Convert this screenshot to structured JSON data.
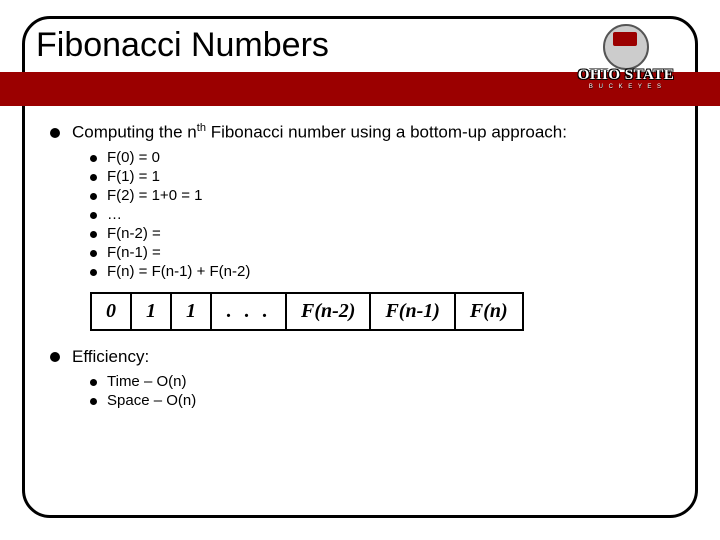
{
  "title": "Fibonacci Numbers",
  "logo": {
    "main": "OHIO STATE",
    "sub": "B U C K E Y E S"
  },
  "sections": [
    {
      "heading_pre": "Computing the n",
      "heading_sup": "th",
      "heading_post": " Fibonacci number using a bottom-up approach:",
      "items": [
        "F(0) = 0",
        "F(1) = 1",
        "F(2) = 1+0 = 1",
        "  …",
        "F(n-2) =",
        "F(n-1) =",
        "F(n) = F(n-1) + F(n-2)"
      ]
    },
    {
      "heading": "Efficiency:",
      "items": [
        "Time – O(n)",
        "Space – O(n)"
      ]
    }
  ],
  "table": [
    "0",
    "1",
    "1",
    ". . .",
    "F(n-2)",
    "F(n-1)",
    "F(n)"
  ],
  "chart_data": {
    "type": "table",
    "title": "Bottom-up Fibonacci array",
    "cells": [
      "0",
      "1",
      "1",
      "…",
      "F(n-2)",
      "F(n-1)",
      "F(n)"
    ]
  }
}
